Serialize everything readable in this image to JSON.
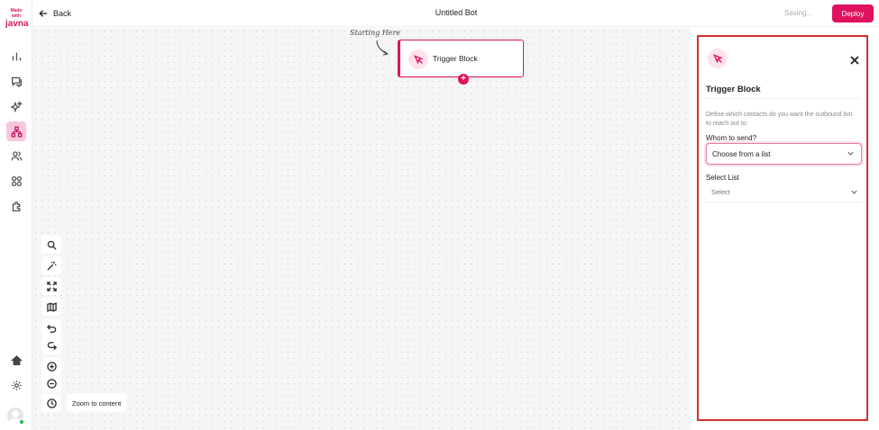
{
  "brand": {
    "logo_line1": "Made with",
    "logo_line2": "javna"
  },
  "header": {
    "back_label": "Back",
    "title": "Untitled Bot",
    "status": "Saving...",
    "deploy_label": "Deploy"
  },
  "sidebar": {
    "items": [
      {
        "icon": "bar-chart-icon"
      },
      {
        "icon": "chat-icon"
      },
      {
        "icon": "sparkles-icon"
      },
      {
        "icon": "flow-icon",
        "active": true
      },
      {
        "icon": "contacts-icon"
      },
      {
        "icon": "apps-icon"
      },
      {
        "icon": "puzzle-icon"
      },
      {
        "icon": "home-icon"
      },
      {
        "icon": "gear-icon"
      }
    ]
  },
  "canvas": {
    "annotation": "Starting Here",
    "node": {
      "label": "Trigger Block",
      "icon": "cursor-icon"
    },
    "tools": [
      "search-icon",
      "magic-wand-icon",
      "expand-icon",
      "map-icon",
      "undo-icon",
      "redo-icon",
      "zoom-in-icon",
      "zoom-out-icon",
      "history-icon"
    ],
    "zoom_to_content_label": "Zoom to content"
  },
  "panel": {
    "title": "Trigger Block",
    "description": "Define which contacts do you want the outbound bot to reach out to.",
    "field1": {
      "label": "Whom to send?",
      "value": "Choose from a list"
    },
    "field2": {
      "label": "Select List",
      "placeholder": "Select"
    }
  },
  "colors": {
    "accent": "#e0115f",
    "panel_border": "#d32f2f"
  }
}
